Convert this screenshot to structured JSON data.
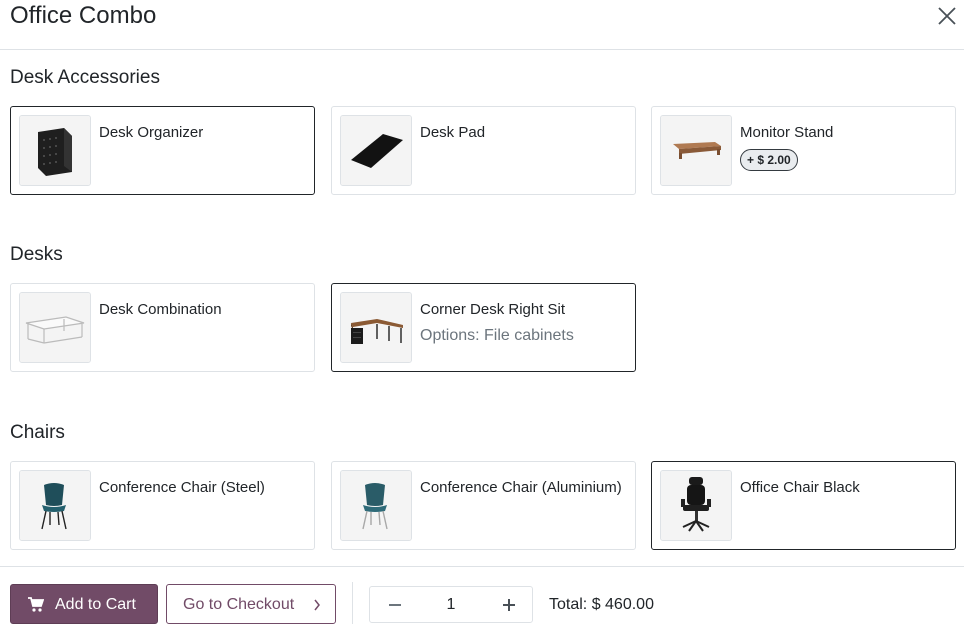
{
  "dialog": {
    "title": "Office Combo"
  },
  "sections": [
    {
      "title": "Desk Accessories",
      "items": [
        {
          "name": "Desk Organizer",
          "selected": true,
          "image": "desk-organizer-image"
        },
        {
          "name": "Desk Pad",
          "selected": false,
          "image": "desk-pad-image"
        },
        {
          "name": "Monitor Stand",
          "selected": false,
          "price": "+ $ 2.00",
          "image": "monitor-stand-image"
        }
      ]
    },
    {
      "title": "Desks",
      "items": [
        {
          "name": "Desk Combination",
          "selected": false,
          "image": "desk-combination-image"
        },
        {
          "name": "Corner Desk Right Sit",
          "selected": true,
          "options": "Options: File cabinets",
          "image": "corner-desk-image"
        }
      ]
    },
    {
      "title": "Chairs",
      "items": [
        {
          "name": "Conference Chair (Steel)",
          "selected": false,
          "image": "conference-chair-steel-image"
        },
        {
          "name": "Conference Chair (Aluminium)",
          "selected": false,
          "image": "conference-chair-aluminium-image"
        },
        {
          "name": "Office Chair Black",
          "selected": true,
          "image": "office-chair-black-image"
        }
      ]
    }
  ],
  "footer": {
    "add_to_cart": "Add to Cart",
    "go_to_checkout": "Go to Checkout",
    "quantity": "1",
    "total": "Total: $ 460.00"
  },
  "colors": {
    "brand": "#714b67",
    "border": "#dee2e6",
    "selected_border": "#212529",
    "muted_text": "#6c757d"
  },
  "icons": [
    "close-icon",
    "cart-icon",
    "chevron-right-icon",
    "minus-icon",
    "plus-icon"
  ]
}
